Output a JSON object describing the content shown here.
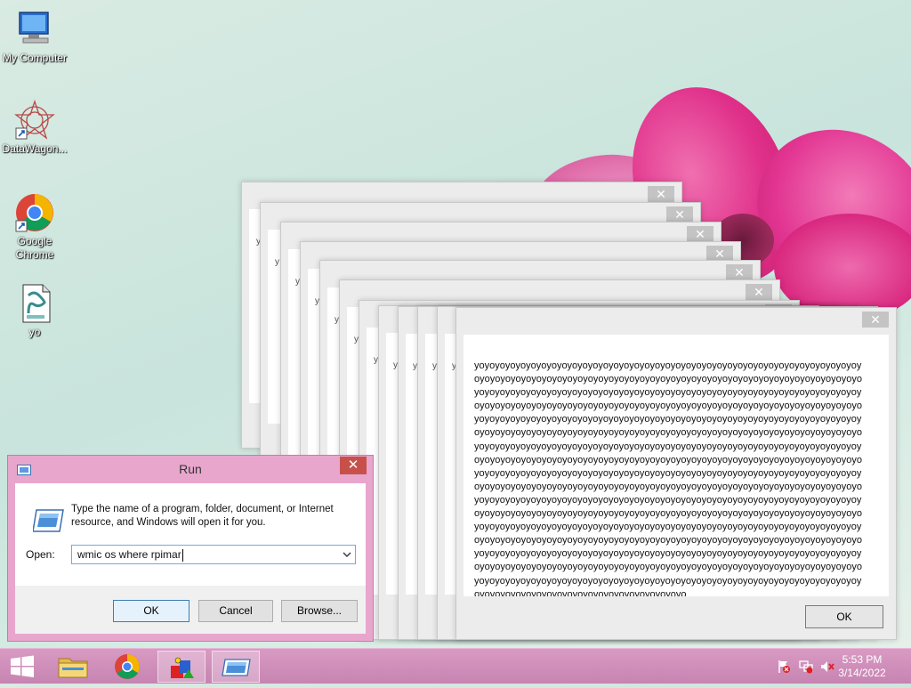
{
  "desktop": {
    "icons": [
      {
        "label": "My Computer"
      },
      {
        "label": "DataWagon..."
      },
      {
        "label": "Google Chrome"
      },
      {
        "label": "yo"
      }
    ]
  },
  "message_box": {
    "text": "yoyoyoyoyoyoyoyoyoyoyoyoyoyoyoyoyoyoyoyoyoyoyoyoyoyoyoyoyoyoyoyoyoyoyoyoyoyoyoyoyoyoyoyoyoyoyoyoyoyoyoyoyoyoyoyoyoyoyoyoyoyoyoyoyoyoyoyoyoyoyoyoyoyoyoyoyoyoyoyoyoyoyoyoyoyoyoyoyoyoyoyoyoyoyoyoyoyoyoyoyoyoyoyoyoyoyoyoyoyoyoyoyoyoyoyoyoyoyoyoyoyoyoyoyoyoyoyoyoyoyoyoyoyoyoyoyoyoyoyoyoyoyoyoyoyoyoyoyoyoyoyoyoyoyoyoyoyoyoyoyoyoyoyoyoyoyoyoyoyoyoyoyoyoyoyoyoyoyoyoyoyoyoyoyoyoyoyoyoyoyoyoyoyoyoyoyoyoyoyoyoyoyoyoyoyoyoyoyoyoyoyoyoyoyoyoyoyoyoyoyoyoyoyoyoyoyoyoyoyoyoyoyoyoyoyoyoyoyoyoyoyoyoyoyoyoyoyoyoyoyoyoyoyoyoyoyoyoyoyoyoyoyoyoyoyoyoyoyoyoyoyoyoyoyoyoyoyoyoyoyoyoyoyoyoyoyoyoyoyoyoyoyoyoyoyoyoyoyoyoyoyoyoyoyoyoyoyoyoyoyoyoyoyoyoyoyoyoyoyoyoyoyoyoyoyoyoyoyoyoyoyoyoyoyoyoyoyoyoyoyoyoyoyoyoyoyoyoyoyoyoyoyoyoyoyoyoyoyoyoyoyoyoyoyoyoyoyoyoyoyoyoyoyoyoyoyoyoyoyoyoyoyoyoyoyoyoyoyoyoyoyoyoyoyoyoyoyoyoyoyoyoyoyoyoyoyoyoyoyoyoyoyoyoyoyoyoyoyoyoyoyoyoyoyoyoyoyoyoyoyoyoyoyoyoyoyoyoyoyoyoyoyoyoyoyoyoyoyoyoyoyoyoyoyoyoyoyoyoyoyoyoyoyoyoyoyoyoyoyoyoyoyoyoyoyoyoyoyoyoyoyoyoyoyoyoyoyoyoyoyoyoyoyoyoyoyoyoyoyoyoyoyoyoyoyoyoyoyoyoyoyoyoyoyoyoyoyoyoyoyoyoyoyoyoyoyoyoyoyoyoyoyoyoyoyoyoyoyoyoyoyoyoyoyoyoyoyoyoyoyoyoyoyoyoyoyoyoyoyoyoyoyoyoyoyoyoyoyoyoyoyoyoyoyoyoyoyoyoyoyoyoyoyoyoyoyoyoyoyoyoyoyoyoyoyoyoyoyoyoyoyoyoyoyoyoyoyoyoyoyoyoyoyoyoyoyoyoyoyoyoyoyoyoyoyoyoyoyoyoyoyoyoyoyoyoyoyoyoyoyoyoyoyoyoyoyoyoyoyoyoyoyoyoyoyoyoyo",
    "ok_label": "OK",
    "close_glyph": "✕",
    "stack_glyph": "y"
  },
  "run_dialog": {
    "title": "Run",
    "close_glyph": "✕",
    "description": "Type the name of a program, folder, document, or Internet resource, and Windows will open it for you.",
    "open_label": "Open:",
    "open_value": "wmic os where rpimar",
    "ok_label": "OK",
    "cancel_label": "Cancel",
    "browse_label": "Browse..."
  },
  "taskbar": {
    "time": "5:53 PM",
    "date": "3/14/2022"
  },
  "colors": {
    "accent": "#c7504b",
    "taskbar": "#c784b2",
    "dialog_frame": "#e8a6cd"
  }
}
